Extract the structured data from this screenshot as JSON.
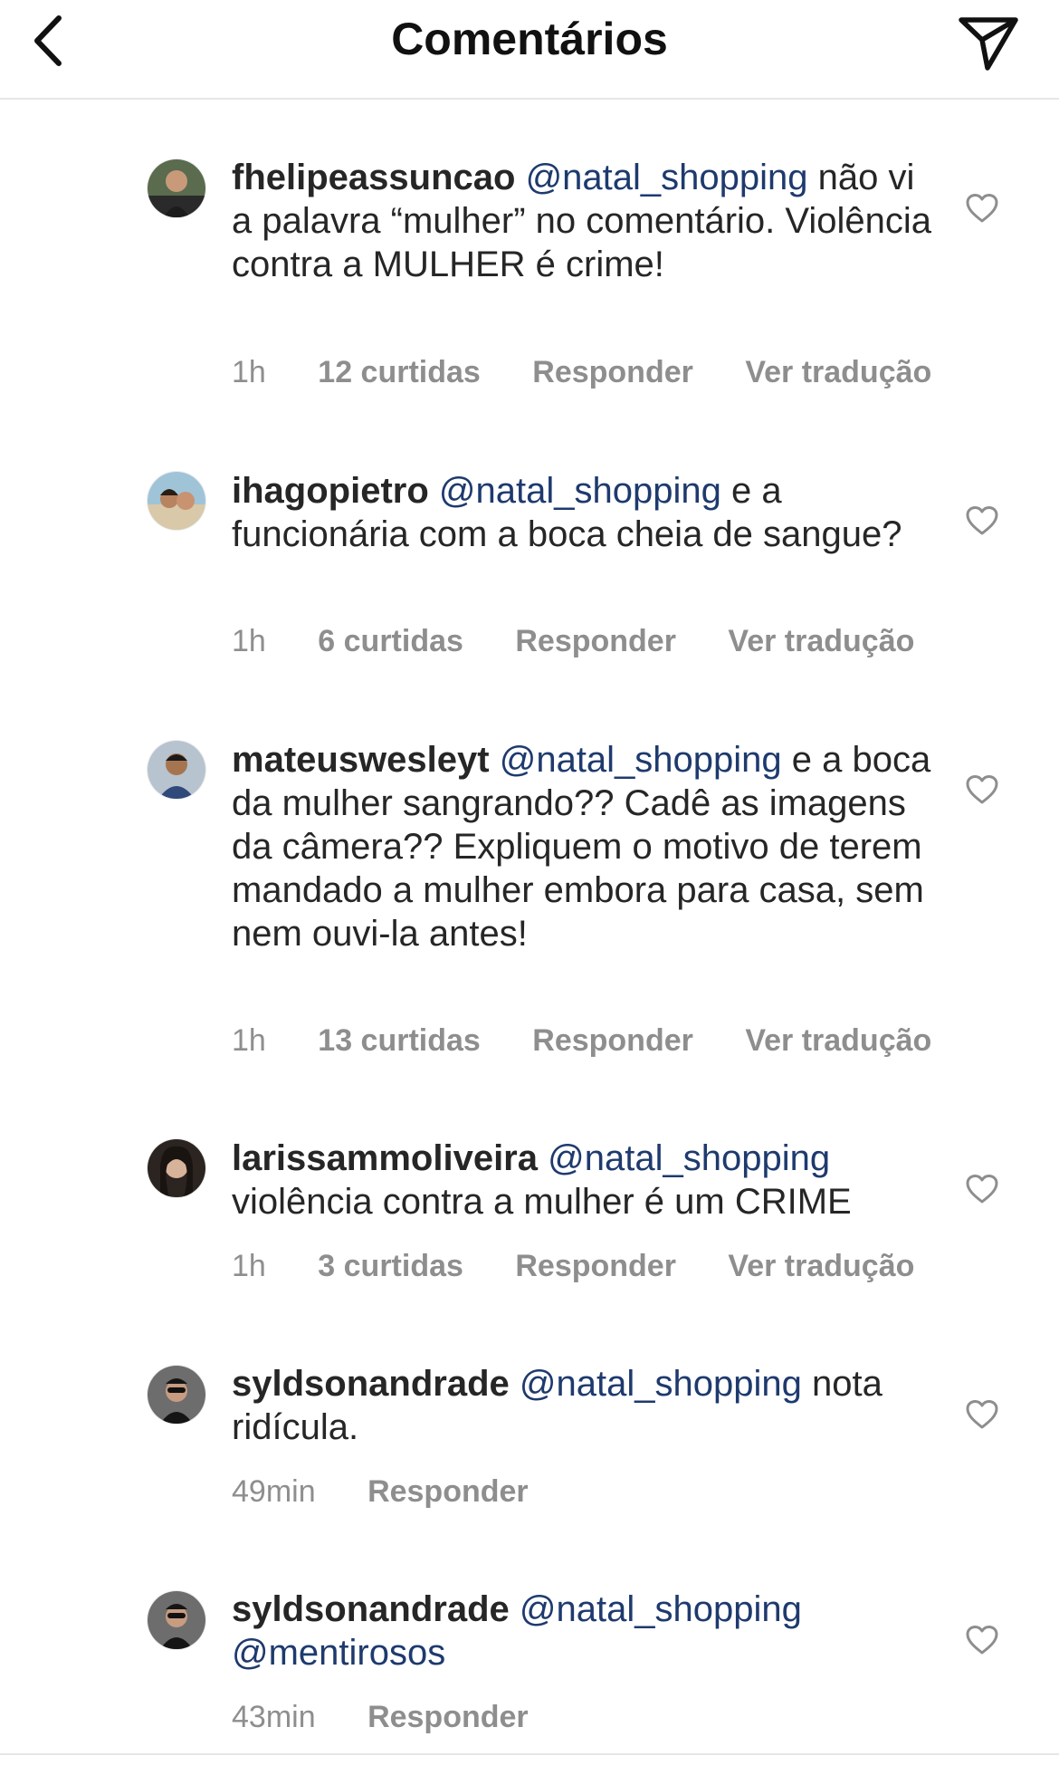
{
  "header": {
    "title": "Comentários",
    "back_icon": "chevron-left-icon",
    "send_icon": "paper-plane-icon"
  },
  "comments": [
    {
      "username": "fhelipeassuncao",
      "mention": "@natal_shopping",
      "text": "não vi a palavra “mulher” no comentário. Violência contra a MULHER é crime!",
      "time": "1h",
      "likes": "12 curtidas",
      "reply": "Responder",
      "translate": "Ver tradução"
    },
    {
      "username": "ihagopietro",
      "mention": "@natal_shopping",
      "text": "e a funcionária com a boca cheia de sangue?",
      "time": "1h",
      "likes": "6 curtidas",
      "reply": "Responder",
      "translate": "Ver tradução"
    },
    {
      "username": "mateuswesleyt",
      "mention": "@natal_shopping",
      "text": "e a boca da mulher sangrando?? Cadê as imagens da câmera?? Expliquem o motivo de terem mandado a mulher embora para casa, sem nem ouvi-la antes!",
      "time": "1h",
      "likes": "13 curtidas",
      "reply": "Responder",
      "translate": "Ver tradução"
    },
    {
      "username": "larissammoliveira",
      "mention": "@natal_shopping",
      "text": "violência contra a mulher é um CRIME",
      "time": "1h",
      "likes": "3 curtidas",
      "reply": "Responder",
      "translate": "Ver tradução"
    },
    {
      "username": "syldsonandrade",
      "mention": "@natal_shopping",
      "text": "nota ridícula.",
      "time": "49min",
      "reply": "Responder"
    },
    {
      "username": "syldsonandrade",
      "mention": "@natal_shopping",
      "mention2": "@mentirosos",
      "time": "43min",
      "reply": "Responder"
    }
  ],
  "colors": {
    "text": "#262626",
    "mention": "#1e3a6e",
    "meta": "#8e8e8e",
    "divider": "#e6e6e6"
  }
}
